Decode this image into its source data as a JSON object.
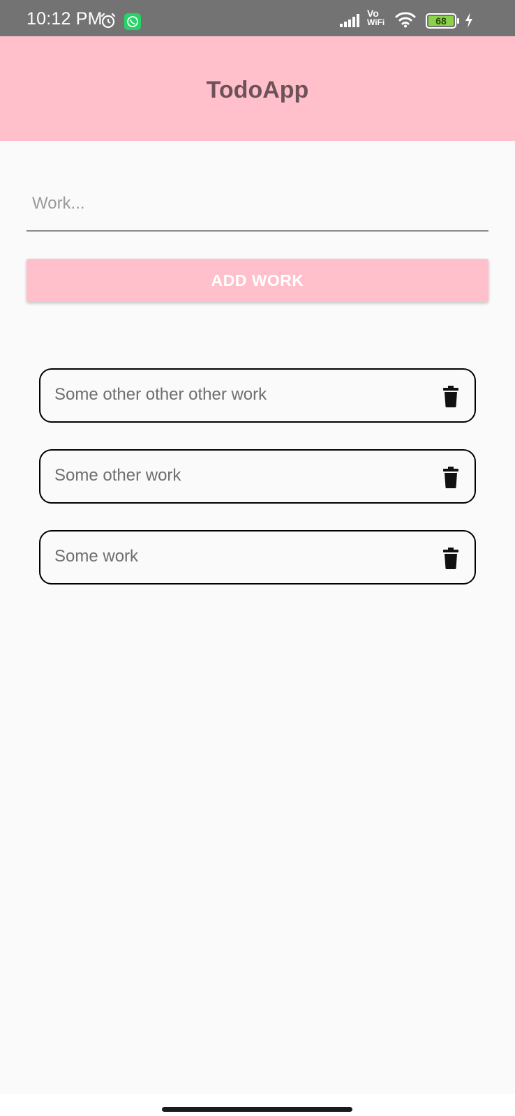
{
  "status_bar": {
    "time": "10:12 PM",
    "battery": "68",
    "vowifi_top": "Vo",
    "vowifi_bottom": "WiFi",
    "icons": [
      "alarm-icon",
      "whatsapp-icon",
      "signal-icon",
      "vowifi-icon",
      "wifi-icon",
      "battery-icon",
      "charging-icon"
    ]
  },
  "app_bar": {
    "title": "TodoApp",
    "background": "#ffc0cb",
    "title_color": "#6d5258"
  },
  "form": {
    "input_value": "",
    "input_placeholder": "Work...",
    "add_button_label": "ADD WORK",
    "button_color": "#ffc0cb"
  },
  "todos": [
    {
      "text": "Some other other other work",
      "icon": "trash-icon"
    },
    {
      "text": "Some other work",
      "icon": "trash-icon"
    },
    {
      "text": "Some work",
      "icon": "trash-icon"
    }
  ]
}
